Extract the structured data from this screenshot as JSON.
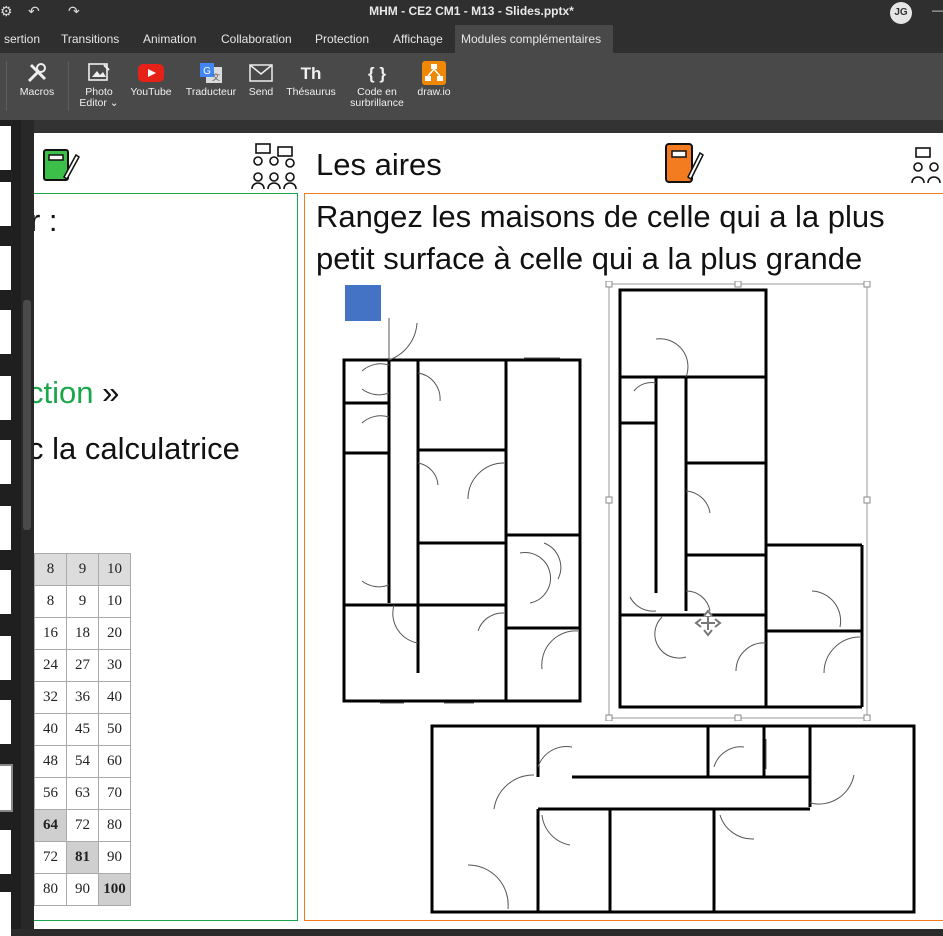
{
  "titlebar": {
    "title": "MHM - CE2 CM1 - M13 - Slides.pptx*",
    "avatar": "JG"
  },
  "tabs": [
    "sertion",
    "Transitions",
    "Animation",
    "Collaboration",
    "Protection",
    "Affichage",
    "Modules complémentaires"
  ],
  "ribbon": {
    "macros": "Macros",
    "photo_editor_1": "Photo",
    "photo_editor_2": "Editor ⌄",
    "youtube": "YouTube",
    "traducteur": "Traducteur",
    "send": "Send",
    "thesaurus": "Thésaurus",
    "thesaurus_glyph": "Th",
    "code_1": "Code en",
    "code_2": "surbrillance",
    "code_glyph": "{ }",
    "drawio": "draw.io"
  },
  "slide": {
    "heading": "Les aires",
    "left_line1": "r :",
    "left_line2_green": "ction",
    "left_line2_rest": " »",
    "left_line3": "c la calculatrice",
    "instruction_line1": "Rangez les maisons de celle qui a la plus",
    "instruction_line2": "petit surface à celle qui a la plus grande"
  },
  "table": {
    "rows": [
      [
        "8",
        "9",
        "10"
      ],
      [
        "8",
        "9",
        "10"
      ],
      [
        "16",
        "18",
        "20"
      ],
      [
        "24",
        "27",
        "30"
      ],
      [
        "32",
        "36",
        "40"
      ],
      [
        "40",
        "45",
        "50"
      ],
      [
        "48",
        "54",
        "60"
      ],
      [
        "56",
        "63",
        "70"
      ],
      [
        "64",
        "72",
        "80"
      ],
      [
        "72",
        "81",
        "90"
      ],
      [
        "80",
        "90",
        "100"
      ]
    ]
  },
  "colors": {
    "green": "#1aa64a",
    "orange": "#f47c20",
    "shape_blue": "#4472c4"
  }
}
